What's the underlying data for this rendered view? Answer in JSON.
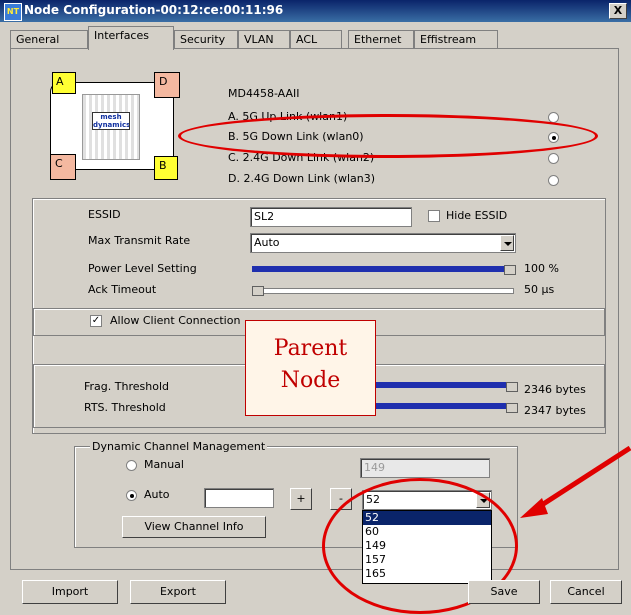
{
  "window": {
    "title": "Node Configuration-00:12:ce:00:11:96",
    "close_label": "X",
    "app_icon": "app-icon"
  },
  "tabs": [
    {
      "label": "General"
    },
    {
      "label": "Interfaces",
      "active": true
    },
    {
      "label": "Security"
    },
    {
      "label": "VLAN"
    },
    {
      "label": "ACL"
    },
    {
      "label": "Ethernet"
    },
    {
      "label": "Effistream"
    }
  ],
  "device": {
    "model": "MD4458-AAII",
    "logo_text": "mesh dynamics",
    "ports": [
      "A",
      "D",
      "C",
      "B"
    ],
    "interfaces": [
      {
        "label": "A. 5G  Up Link (wlan1)",
        "selected": false
      },
      {
        "label": "B. 5G  Down Link (wlan0)",
        "selected": true
      },
      {
        "label": "C. 2.4G  Down Link (wlan2)",
        "selected": false
      },
      {
        "label": "D. 2.4G  Down Link (wlan3)",
        "selected": false
      }
    ]
  },
  "settings": {
    "essid_label": "ESSID",
    "essid_value": "SL2",
    "hide_essid_label": "Hide ESSID",
    "hide_essid_checked": false,
    "max_rate_label": "Max Transmit Rate",
    "max_rate_value": "Auto",
    "power_label": "Power Level Setting",
    "power_value": "100 %",
    "power_level": 1.0,
    "ack_label": "Ack Timeout",
    "ack_value": "50 µs",
    "ack_level": 0.0,
    "allow_client_label": "Allow Client Connection",
    "allow_client_checked": true,
    "frag_label": "Frag. Threshold",
    "frag_value": "2346 bytes",
    "frag_level": 1.0,
    "rts_label": "RTS. Threshold",
    "rts_value": "2347 bytes",
    "rts_level": 1.0
  },
  "dcm": {
    "group_label": "Dynamic Channel Management",
    "manual_label": "Manual",
    "manual_selected": false,
    "auto_label": "Auto",
    "auto_selected": true,
    "manual_channel": "149",
    "auto_input": "",
    "plus_label": "+",
    "minus_label": "-",
    "channel_selected": "52",
    "channel_options": [
      "52",
      "60",
      "149",
      "157",
      "165"
    ],
    "view_info_label": "View Channel Info"
  },
  "annotation": {
    "line1": "Parent",
    "line2": "Node",
    "color": "#c00000"
  },
  "footer": {
    "import_label": "Import",
    "export_label": "Export",
    "save_label": "Save",
    "cancel_label": "Cancel"
  }
}
